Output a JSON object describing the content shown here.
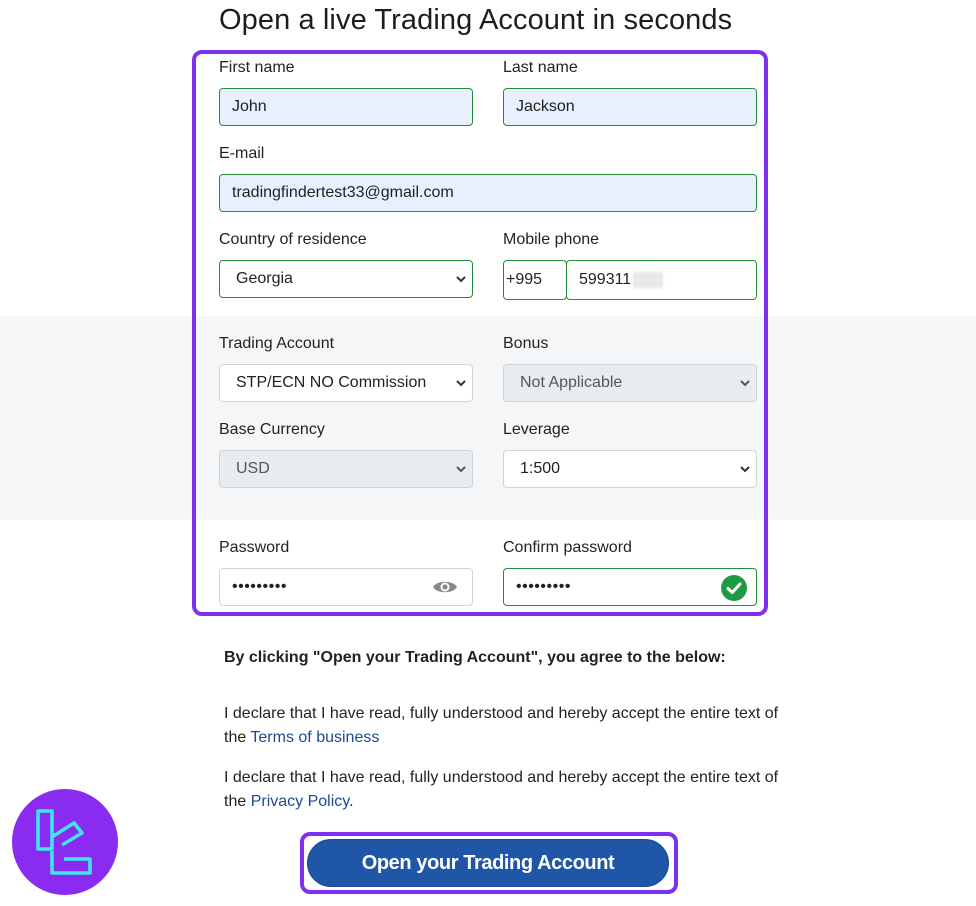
{
  "page": {
    "title": "Open a live Trading Account in seconds"
  },
  "form": {
    "first_name": {
      "label": "First name",
      "value": "John"
    },
    "last_name": {
      "label": "Last name",
      "value": "Jackson"
    },
    "email": {
      "label": "E-mail",
      "value": "tradingfindertest33@gmail.com"
    },
    "country": {
      "label": "Country of residence",
      "selected": "Georgia"
    },
    "mobile": {
      "label": "Mobile phone",
      "code": "+995",
      "number": "599311"
    },
    "trading_account": {
      "label": "Trading Account",
      "selected": "STP/ECN NO Commission"
    },
    "bonus": {
      "label": "Bonus",
      "selected": "Not Applicable"
    },
    "base_currency": {
      "label": "Base Currency",
      "selected": "USD"
    },
    "leverage": {
      "label": "Leverage",
      "selected": "1:500"
    },
    "password": {
      "label": "Password",
      "value": "•••••••••"
    },
    "confirm_password": {
      "label": "Confirm password",
      "value": "•••••••••"
    }
  },
  "agreement": {
    "heading": "By clicking \"Open your Trading Account\", you agree to the below:",
    "declaration_1_text": "I declare that I have read, fully understood and hereby accept the entire text of the",
    "declaration_1_link": "Terms of business",
    "declaration_2_text": "I declare that I have read, fully understood and hereby accept the entire text of the",
    "declaration_2_link": "Privacy Policy",
    "declaration_2_suffix": "."
  },
  "submit": {
    "label": "Open your Trading Account"
  },
  "icons": {
    "password_toggle": "eye-icon",
    "confirm_valid": "check-circle-icon",
    "select_arrow": "chevron-down-icon",
    "brand": "tradingfinder-logo"
  },
  "colors": {
    "highlight": "#7e2ff0",
    "button": "#1f56a8",
    "valid": "#1f8f3a",
    "filled_bg": "#e8f0fe",
    "link": "#1b4a93"
  }
}
